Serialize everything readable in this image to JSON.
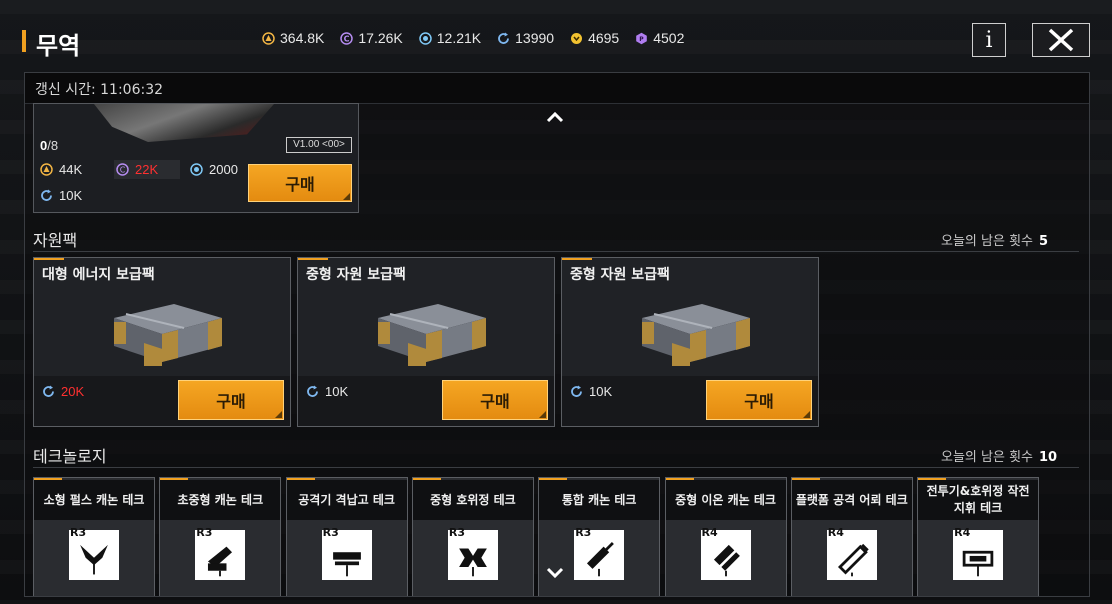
{
  "header": {
    "title": "무역",
    "resources": [
      {
        "icon": "energy-core-icon",
        "value": "364.8K",
        "color": "#f2b544"
      },
      {
        "icon": "purple-credit-icon",
        "value": "17.26K",
        "color": "#b58cf0"
      },
      {
        "icon": "blue-crystal-icon",
        "value": "12.21K",
        "color": "#7fc8f5"
      },
      {
        "icon": "cycle-token-icon",
        "value": "13990",
        "color": "#7fb8f0"
      },
      {
        "icon": "gold-medal-icon",
        "value": "4695",
        "color": "#f2c230"
      },
      {
        "icon": "purple-gem-icon",
        "value": "4502",
        "color": "#b07df0"
      }
    ],
    "info_label": "i"
  },
  "refresh": {
    "label": "갱신 시간: 11:06:32"
  },
  "featured": {
    "count_owned": "0",
    "count_total": "/8",
    "version": "V1.00 <00>",
    "prices": [
      {
        "icon": "energy-core-icon",
        "value": "44K",
        "color": "#f2b544",
        "insufficient": false
      },
      {
        "icon": "purple-credit-icon",
        "value": "22K",
        "color": "#b58cf0",
        "insufficient": true
      },
      {
        "icon": "blue-crystal-icon",
        "value": "2000",
        "color": "#7fc8f5",
        "insufficient": false
      },
      {
        "icon": "cycle-token-icon",
        "value": "10K",
        "color": "#7fb8f0",
        "insufficient": false
      }
    ],
    "buy_label": "구매"
  },
  "resource_packs": {
    "section_title": "자원팩",
    "remaining_label": "오늘의 남은 횟수",
    "remaining_count": "5",
    "items": [
      {
        "name": "대형 에너지 보급팩",
        "price": "20K",
        "insufficient": true,
        "buy_label": "구매"
      },
      {
        "name": "중형 자원 보급팩",
        "price": "10K",
        "insufficient": false,
        "buy_label": "구매"
      },
      {
        "name": "중형 자원 보급팩",
        "price": "10K",
        "insufficient": false,
        "buy_label": "구매"
      }
    ]
  },
  "technology": {
    "section_title": "테크놀로지",
    "remaining_label": "오늘의 남은 횟수",
    "remaining_count": "10",
    "items": [
      {
        "name": "소형 펄스 캐논 테크",
        "tier": "R3",
        "icon": "pulse-cannon-icon"
      },
      {
        "name": "초중형 캐논 테크",
        "tier": "R3",
        "icon": "heavy-cannon-icon"
      },
      {
        "name": "공격기 격납고 테크",
        "tier": "R3",
        "icon": "hangar-icon"
      },
      {
        "name": "중형 호위정 테크",
        "tier": "R3",
        "icon": "frigate-icon"
      },
      {
        "name": "통합 캐논 테크",
        "tier": "R3",
        "icon": "integrated-cannon-icon"
      },
      {
        "name": "중형 이온 캐논 테크",
        "tier": "R4",
        "icon": "ion-cannon-icon"
      },
      {
        "name": "플랫폼 공격 어뢰 테크",
        "tier": "R4",
        "icon": "torpedo-icon"
      },
      {
        "name": "전투기&호위정 작전 지휘 테크",
        "tier": "R4",
        "icon": "command-icon"
      }
    ]
  }
}
